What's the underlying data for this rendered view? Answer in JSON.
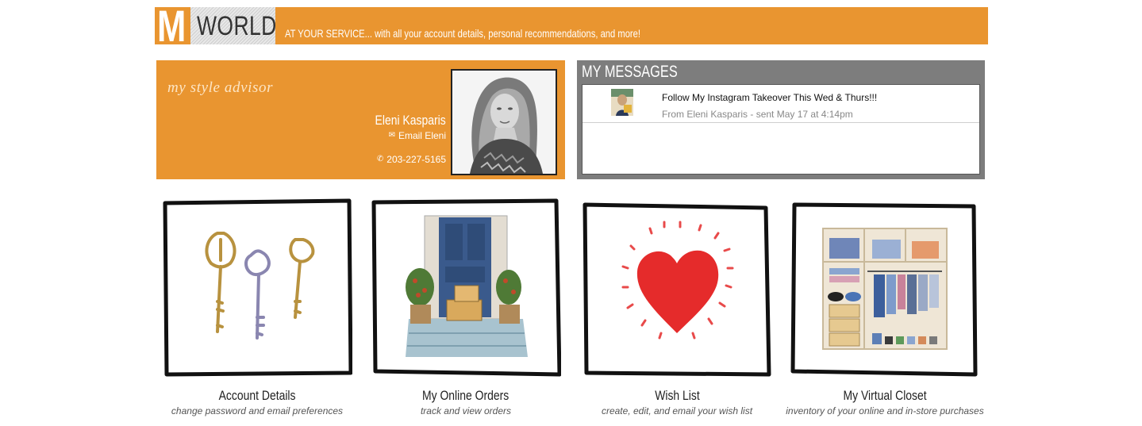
{
  "header": {
    "logo_letter": "M",
    "logo_word": "WORLD",
    "tagline": "AT YOUR SERVICE... with all your account details, personal recommendations, and more!",
    "accent_color": "#e99530"
  },
  "advisor": {
    "title": "my style advisor",
    "name": "Eleni Kasparis",
    "email_label": "Email Eleni",
    "phone": "203-227-5165"
  },
  "messages": {
    "title": "MY MESSAGES",
    "items": [
      {
        "subject": "Follow My Instagram Takeover This Wed & Thurs!!!",
        "meta": "From Eleni Kasparis - sent May 17 at 4:14pm"
      }
    ]
  },
  "tiles": [
    {
      "title": "Account Details",
      "subtitle": "change password and email preferences",
      "icon": "keys-icon"
    },
    {
      "title": "My Online Orders",
      "subtitle": "track and view orders",
      "icon": "front-door-package-icon"
    },
    {
      "title": "Wish List",
      "subtitle": "create, edit, and email your wish list",
      "icon": "heart-icon"
    },
    {
      "title": "My Virtual Closet",
      "subtitle": "inventory of your online and in-store purchases",
      "icon": "closet-icon"
    }
  ]
}
